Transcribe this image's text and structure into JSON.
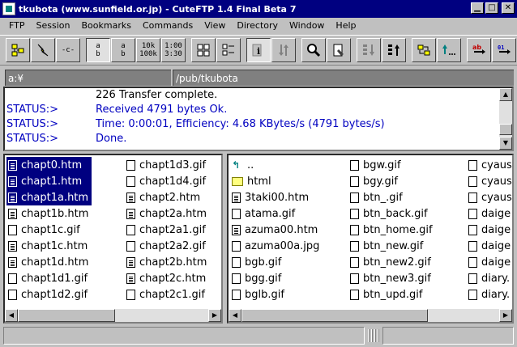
{
  "window": {
    "title": "tkubota (www.sunfield.or.jp) - CuteFTP 1.4 Final Beta 7",
    "min_glyph": "▁",
    "max_glyph": "□",
    "close_glyph": "✕"
  },
  "menu": [
    "FTP",
    "Session",
    "Bookmarks",
    "Commands",
    "View",
    "Directory",
    "Window",
    "Help"
  ],
  "toolbar": {
    "quick_connect_label": "-c-",
    "ascii_top": "a",
    "ascii_bottom": "b",
    "binary_top": "a",
    "binary_bottom": "b",
    "k10": "10k",
    "k100": "100k",
    "t100": "1:00",
    "t330": "3:30"
  },
  "paths": {
    "local": "a:¥",
    "remote": "/pub/tkubota"
  },
  "log": [
    {
      "key": "",
      "text": "226 Transfer complete."
    },
    {
      "key": "STATUS:>",
      "text": "Received 4791 bytes Ok."
    },
    {
      "key": "STATUS:>",
      "text": "Time: 0:00:01, Efficiency: 4.68 KBytes/s (4791 bytes/s)"
    },
    {
      "key": "STATUS:>",
      "text": "Done."
    }
  ],
  "local_files": {
    "col1": [
      "chapt0.htm",
      "chapt1.htm",
      "chapt1a.htm",
      "chapt1b.htm",
      "chapt1c.gif",
      "chapt1c.htm",
      "chapt1d.htm",
      "chapt1d1.gif",
      "chapt1d2.gif"
    ],
    "col2": [
      "chapt1d3.gif",
      "chapt1d4.gif",
      "chapt2.htm",
      "chapt2a.htm",
      "chapt2a1.gif",
      "chapt2a2.gif",
      "chapt2b.htm",
      "chapt2c.htm",
      "chapt2c1.gif"
    ]
  },
  "remote_files": {
    "col1": [
      "..",
      "html",
      "3taki00.htm",
      "atama.gif",
      "azuma00.htm",
      "azuma00a.jpg",
      "bgb.gif",
      "bgg.gif",
      "bglb.gif"
    ],
    "col2": [
      "bgw.gif",
      "bgy.gif",
      "btn_.gif",
      "btn_back.gif",
      "btn_home.gif",
      "btn_new.gif",
      "btn_new2.gif",
      "btn_new3.gif",
      "btn_upd.gif"
    ],
    "col3": [
      "cyaus",
      "cyaus",
      "cyaus",
      "daige",
      "daige",
      "daige",
      "daige",
      "diary.",
      "diary."
    ]
  }
}
